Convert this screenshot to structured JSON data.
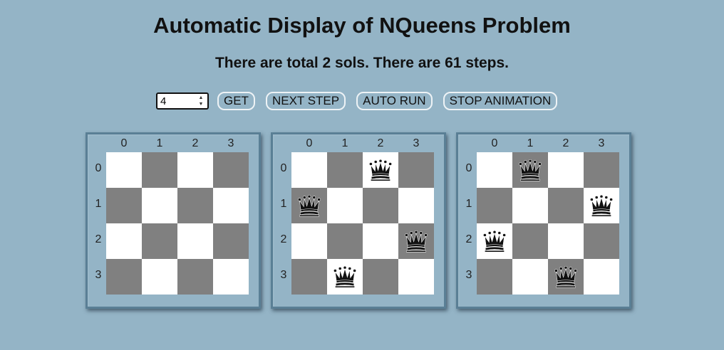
{
  "title": "Automatic Display of NQueens Problem",
  "subtitle": "There are total 2 sols. There are 61 steps.",
  "controls": {
    "n_value": "4",
    "get_label": "GET",
    "next_step_label": "NEXT STEP",
    "auto_run_label": "AUTO RUN",
    "stop_animation_label": "STOP ANIMATION"
  },
  "board_labels": {
    "cols": [
      "0",
      "1",
      "2",
      "3"
    ],
    "rows": [
      "0",
      "1",
      "2",
      "3"
    ]
  },
  "boards": [
    {
      "queens": []
    },
    {
      "queens": [
        [
          0,
          2
        ],
        [
          1,
          0
        ],
        [
          2,
          3
        ],
        [
          3,
          1
        ]
      ]
    },
    {
      "queens": [
        [
          0,
          1
        ],
        [
          1,
          3
        ],
        [
          2,
          0
        ],
        [
          3,
          2
        ]
      ]
    }
  ],
  "colors": {
    "background": "#94b4c6",
    "light_square": "#ffffff",
    "dark_square": "#808080",
    "queen": "#111111"
  },
  "icons": {
    "queen": "queen-chess-icon",
    "spinner_up": "spinner-up-icon",
    "spinner_down": "spinner-down-icon"
  }
}
